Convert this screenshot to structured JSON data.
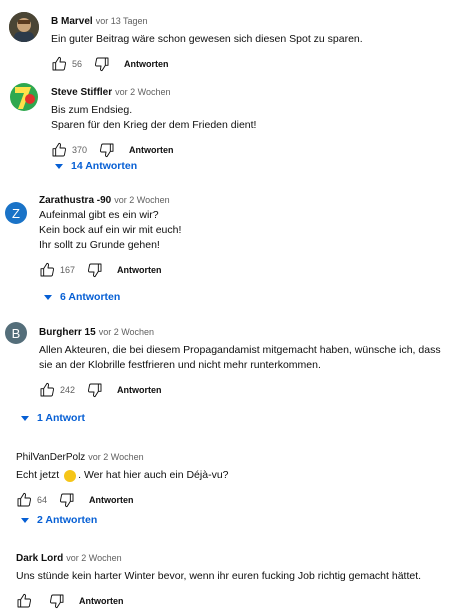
{
  "ui": {
    "reply_label": "Antworten"
  },
  "comments": [
    {
      "author": "B Marvel",
      "time": "vor 13 Tagen",
      "lines": [
        "Ein guter Beitrag wäre schon gewesen sich diesen Spot zu sparen."
      ],
      "likes": "56"
    },
    {
      "author": "Steve Stiffler",
      "time": "vor 2 Wochen",
      "lines": [
        "Bis zum Endsieg.",
        "Sparen für den Krieg der dem Frieden dient!"
      ],
      "likes": "370",
      "replies_label": "14 Antworten"
    },
    {
      "author": "Zarathustra -90",
      "time": "vor 2 Wochen",
      "avatar_letter": "Z",
      "lines": [
        "Aufeinmal gibt es ein wir?",
        "Kein bock auf ein wir mit euch!",
        "Ihr sollt zu Grunde gehen!"
      ],
      "likes": "167",
      "replies_label": "6 Antworten"
    },
    {
      "author": "Burgherr 15",
      "time": "vor 2 Wochen",
      "avatar_letter": "B",
      "lines": [
        "Allen Akteuren, die bei diesem Propagandamist mitgemacht haben, wünsche ich, dass",
        "sie an der Klobrille festfrieren und nicht mehr runterkommen."
      ],
      "likes": "242",
      "replies_label": "1 Antwort"
    },
    {
      "author": "PhilVanDerPolz",
      "time": "vor 2 Wochen",
      "line_before_emoji": "Echt jetzt ",
      "line_after_emoji": ". Wer hat hier auch ein Déjà-vu?",
      "likes": "64",
      "replies_label": "2 Antworten"
    },
    {
      "author": "Dark Lord",
      "time": "vor 2 Wochen",
      "lines": [
        "Uns stünde kein harter Winter bevor, wenn ihr euren fucking Job richtig gemacht hättet."
      ]
    }
  ]
}
